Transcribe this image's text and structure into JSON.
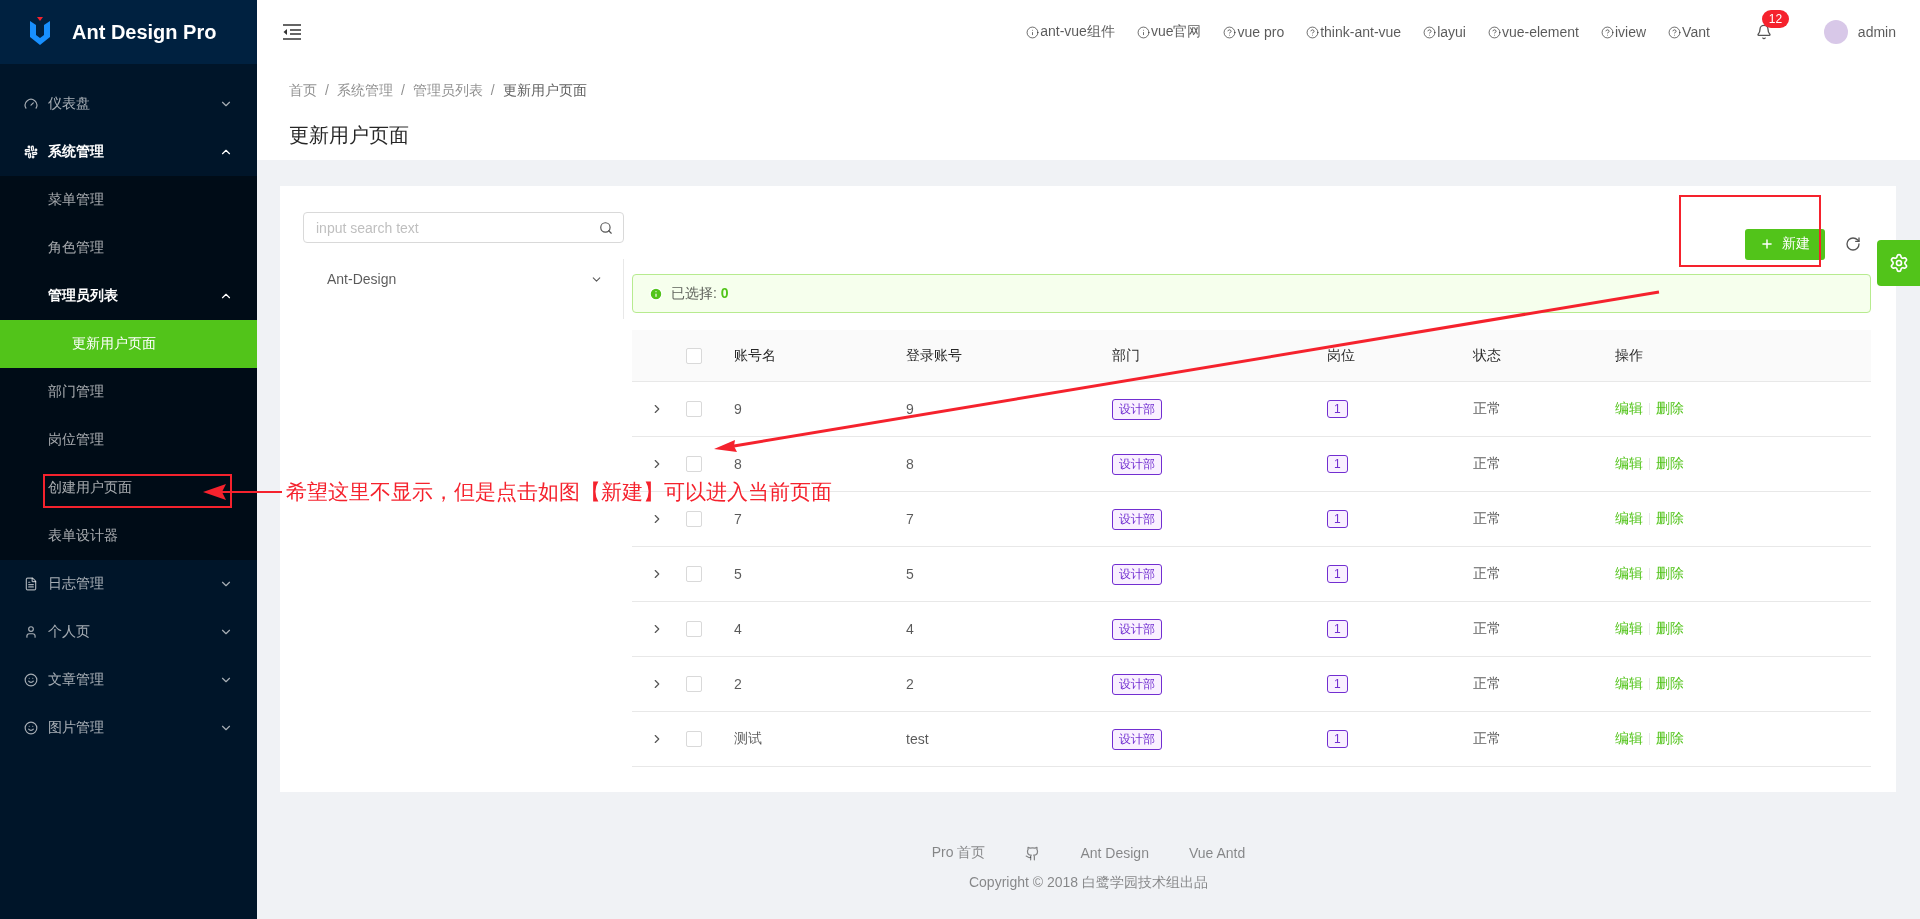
{
  "sidebar": {
    "logo": "Ant Design Pro",
    "menu": [
      {
        "label": "仪表盘",
        "expanded": false,
        "selected": false
      },
      {
        "label": "系统管理",
        "expanded": true,
        "selected": false,
        "children": [
          {
            "label": "菜单管理",
            "selected": false
          },
          {
            "label": "角色管理",
            "selected": false
          },
          {
            "label": "管理员列表",
            "expanded": true,
            "selected": false,
            "children": [
              {
                "label": "更新用户页面",
                "selected": true
              }
            ]
          },
          {
            "label": "部门管理",
            "selected": false
          },
          {
            "label": "岗位管理",
            "selected": false
          },
          {
            "label": "创建用户页面",
            "selected": false
          },
          {
            "label": "表单设计器",
            "selected": false
          }
        ]
      },
      {
        "label": "日志管理",
        "expanded": false,
        "selected": false
      },
      {
        "label": "个人页",
        "expanded": false,
        "selected": false
      },
      {
        "label": "文章管理",
        "expanded": false,
        "selected": false
      },
      {
        "label": "图片管理",
        "expanded": false,
        "selected": false
      }
    ]
  },
  "header": {
    "links": [
      {
        "label": "ant-vue组件",
        "kind": "info"
      },
      {
        "label": "vue官网",
        "kind": "info"
      },
      {
        "label": "vue pro",
        "kind": "help"
      },
      {
        "label": "think-ant-vue",
        "kind": "help"
      },
      {
        "label": "layui",
        "kind": "help"
      },
      {
        "label": "vue-element",
        "kind": "help"
      },
      {
        "label": "iview",
        "kind": "help"
      },
      {
        "label": "Vant",
        "kind": "help"
      }
    ],
    "notification_count": "12",
    "user": "admin"
  },
  "breadcrumb": {
    "separator": "/",
    "items": [
      "首页",
      "系统管理",
      "管理员列表",
      "更新用户页面"
    ]
  },
  "page_title": "更新用户页面",
  "tree": {
    "search": {
      "placeholder": "input search text"
    },
    "nodes": [
      {
        "label": "Ant-Design",
        "expanded": false
      }
    ]
  },
  "toolbar": {
    "new_button": "新建"
  },
  "alert": {
    "label": "已选择:",
    "count": "0"
  },
  "table": {
    "select_all": false,
    "columns": [
      "账号名",
      "登录账号",
      "部门",
      "岗位",
      "状态",
      "操作"
    ],
    "rows": [
      {
        "checked": false,
        "name": "9",
        "login": "9",
        "dept": "设计部",
        "post": "1",
        "status": "正常",
        "actions": [
          "编辑",
          "删除"
        ]
      },
      {
        "checked": false,
        "name": "8",
        "login": "8",
        "dept": "设计部",
        "post": "1",
        "status": "正常",
        "actions": [
          "编辑",
          "删除"
        ]
      },
      {
        "checked": false,
        "name": "7",
        "login": "7",
        "dept": "设计部",
        "post": "1",
        "status": "正常",
        "actions": [
          "编辑",
          "删除"
        ]
      },
      {
        "checked": false,
        "name": "5",
        "login": "5",
        "dept": "设计部",
        "post": "1",
        "status": "正常",
        "actions": [
          "编辑",
          "删除"
        ]
      },
      {
        "checked": false,
        "name": "4",
        "login": "4",
        "dept": "设计部",
        "post": "1",
        "status": "正常",
        "actions": [
          "编辑",
          "删除"
        ]
      },
      {
        "checked": false,
        "name": "2",
        "login": "2",
        "dept": "设计部",
        "post": "1",
        "status": "正常",
        "actions": [
          "编辑",
          "删除"
        ]
      },
      {
        "checked": false,
        "name": "测试",
        "login": "test",
        "dept": "设计部",
        "post": "1",
        "status": "正常",
        "actions": [
          "编辑",
          "删除"
        ]
      }
    ]
  },
  "footer": {
    "links": [
      {
        "kind": "text",
        "label": "Pro 首页"
      },
      {
        "kind": "github"
      },
      {
        "kind": "text",
        "label": "Ant Design"
      },
      {
        "kind": "text",
        "label": "Vue Antd"
      }
    ],
    "copyright": "Copyright © 2018 白鹭学园技术组出品"
  },
  "annotation": {
    "text": "希望这里不显示，但是点击如图【新建】可以进入当前页面"
  }
}
